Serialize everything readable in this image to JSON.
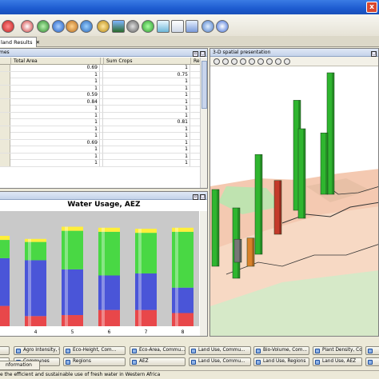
{
  "tab": {
    "label": "land Results",
    "close": "✕"
  },
  "table": {
    "header_title": "mes",
    "columns": [
      "Total Area",
      "Sum Crops",
      "Re"
    ],
    "rows": [
      [
        "0.69",
        "1"
      ],
      [
        "1",
        "0.75"
      ],
      [
        "1",
        "1"
      ],
      [
        "1",
        "1"
      ],
      [
        "0.59",
        "1"
      ],
      [
        "0.84",
        "1"
      ],
      [
        "1",
        "1"
      ],
      [
        "1",
        "1"
      ],
      [
        "1",
        "0.81"
      ],
      [
        "1",
        "1"
      ],
      [
        "1",
        "1"
      ],
      [
        "0.69",
        "1"
      ],
      [
        "1",
        "1"
      ],
      [
        "1",
        "1"
      ],
      [
        "1",
        "1"
      ]
    ]
  },
  "chart": {
    "header_title": "",
    "title": "Water Usage, AEZ"
  },
  "chart_data": {
    "type": "bar",
    "title": "Water Usage, AEZ",
    "categories": [
      "3",
      "4",
      "5",
      "6",
      "7",
      "8"
    ],
    "ylim": [
      0,
      1
    ],
    "series": [
      {
        "color": "#e8474a",
        "values": [
          0.2,
          0.1,
          0.11,
          0.16,
          0.16,
          0.13
        ]
      },
      {
        "color": "#4a55d8",
        "values": [
          0.47,
          0.55,
          0.45,
          0.34,
          0.36,
          0.25
        ]
      },
      {
        "color": "#49d844",
        "values": [
          0.18,
          0.18,
          0.38,
          0.43,
          0.4,
          0.55
        ]
      },
      {
        "color": "#ffef3a",
        "values": [
          0.04,
          0.03,
          0.04,
          0.04,
          0.04,
          0.04
        ]
      }
    ]
  },
  "map": {
    "header_title": "3-D spatial presentation",
    "towers": [
      {
        "color": "#2fb52f",
        "h": 0.78
      },
      {
        "color": "#2fb52f",
        "h": 0.86
      },
      {
        "color": "#2fb52f",
        "h": 0.95
      },
      {
        "color": "#2fb52f",
        "h": 0.6
      },
      {
        "color": "#2fb52f",
        "h": 0.55
      },
      {
        "color": "#2fb52f",
        "h": 0.7
      },
      {
        "color": "#2fb52f",
        "h": 0.48
      },
      {
        "color": "#c43a2a",
        "h": 0.42
      },
      {
        "color": "#d9822a",
        "h": 0.22
      },
      {
        "color": "#777777",
        "h": 0.18
      }
    ]
  },
  "layer_buttons": [
    [
      "",
      "Agro Intensity, C...",
      "Eco-Height, Com...",
      "Eco-Area, Commu...",
      "Land Use, Commu...",
      "Bio-Volume, Com...",
      "Plant Density, Co...",
      ""
    ],
    [
      "",
      "Communes",
      "Regions",
      "AEZ",
      "Land Use, Commu...",
      "Land Use, Regions",
      "Land Use, AEZ",
      ""
    ]
  ],
  "info_tab": "nformation",
  "status_text": "e the efficient and sustainable use of fresh water in Western Africa"
}
